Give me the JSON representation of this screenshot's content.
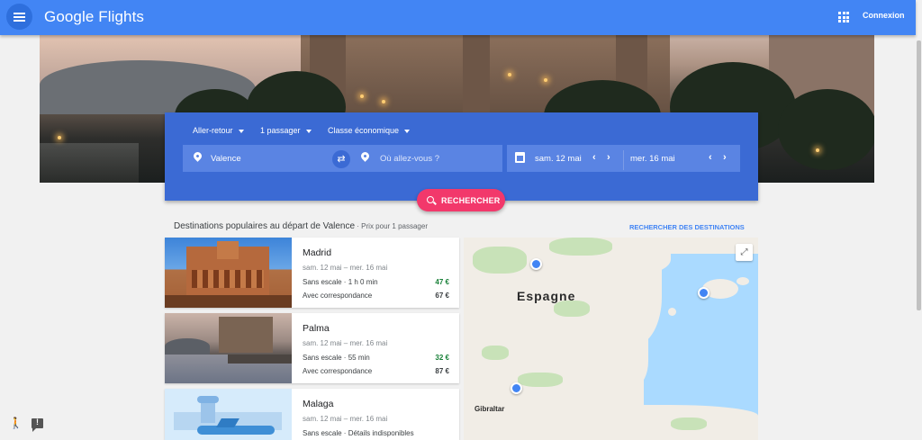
{
  "app": {
    "brand": "Google Flights",
    "signin": "Connexion"
  },
  "search": {
    "trip_type": "Aller-retour",
    "passengers": "1 passager",
    "cabin": "Classe économique",
    "origin": "Valence",
    "destination_placeholder": "Où allez-vous ?",
    "depart_date": "sam. 12 mai",
    "return_date": "mer. 16 mai",
    "search_button": "RECHERCHER",
    "swap_glyph": "⇄",
    "prev_glyph": "‹",
    "next_glyph": "›"
  },
  "section": {
    "title": "Destinations populaires au départ de Valence",
    "subtitle": " · Prix pour 1 passager",
    "explore_link": "RECHERCHER DES DESTINATIONS"
  },
  "destinations": [
    {
      "city": "Madrid",
      "dates": "sam. 12 mai – mer. 16 mai",
      "nonstop": "Sans escale · 1 h 0 min",
      "nonstop_price": "47 €",
      "connecting": "Avec correspondance",
      "connecting_price": "67 €"
    },
    {
      "city": "Palma",
      "dates": "sam. 12 mai – mer. 16 mai",
      "nonstop": "Sans escale · 55 min",
      "nonstop_price": "32 €",
      "connecting": "Avec correspondance",
      "connecting_price": "87 €"
    },
    {
      "city": "Malaga",
      "dates": "sam. 12 mai – mer. 16 mai",
      "nonstop": "Sans escale · Détails indisponibles"
    }
  ],
  "map": {
    "country_label": "Espagne",
    "gibraltar_label": "Gibraltar",
    "expand_glyph": "⤢"
  },
  "icons": {
    "menu": "menu-icon",
    "apps": "apps-grid-icon",
    "pin": "location-pin-icon",
    "calendar": "calendar-icon",
    "search": "search-icon",
    "walk": "pegman-icon",
    "feedback": "feedback-icon"
  },
  "colors": {
    "appbar": "#4285f4",
    "panel": "#3b6ad4",
    "search_button": "#f2386b",
    "price_green": "#188038",
    "map_water": "#aadaff"
  },
  "misc": {
    "walk_glyph": "🚶"
  }
}
